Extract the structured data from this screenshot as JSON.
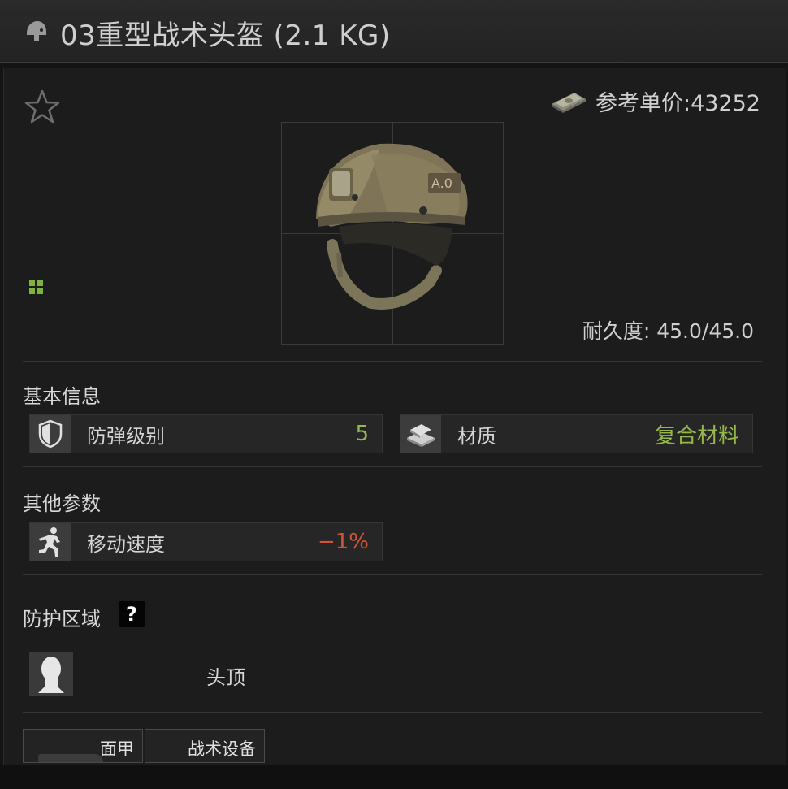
{
  "window": {
    "title": "03重型战术头盔 (2.1 KG)",
    "title_icon": "helmet-icon"
  },
  "header": {
    "favorite_icon": "star-icon",
    "price_icon": "money-stack-icon",
    "price_text": "参考单价:43252"
  },
  "item": {
    "image": "tactical-helmet-image",
    "durability_text": "耐久度: 45.0/45.0",
    "grid_icon": "grid-size-icon"
  },
  "basic_info": {
    "title": "基本信息",
    "attributes": [
      {
        "icon": "shield-icon",
        "label": "防弹级别",
        "value": "5",
        "color": "#96b84a"
      },
      {
        "icon": "material-icon",
        "label": "材质",
        "value": "复合材料",
        "color": "#96b84a"
      }
    ]
  },
  "other_params": {
    "title": "其他参数",
    "attributes": [
      {
        "icon": "running-soldier-icon",
        "label": "移动速度",
        "value": "−1%",
        "color": "#d2553a"
      }
    ]
  },
  "protection": {
    "title": "防护区域",
    "help_label": "?",
    "zone_icon": "head-silhouette-icon",
    "zone_label": "头顶"
  },
  "tabs": [
    {
      "label": "面甲"
    },
    {
      "label": "战术设备"
    }
  ]
}
